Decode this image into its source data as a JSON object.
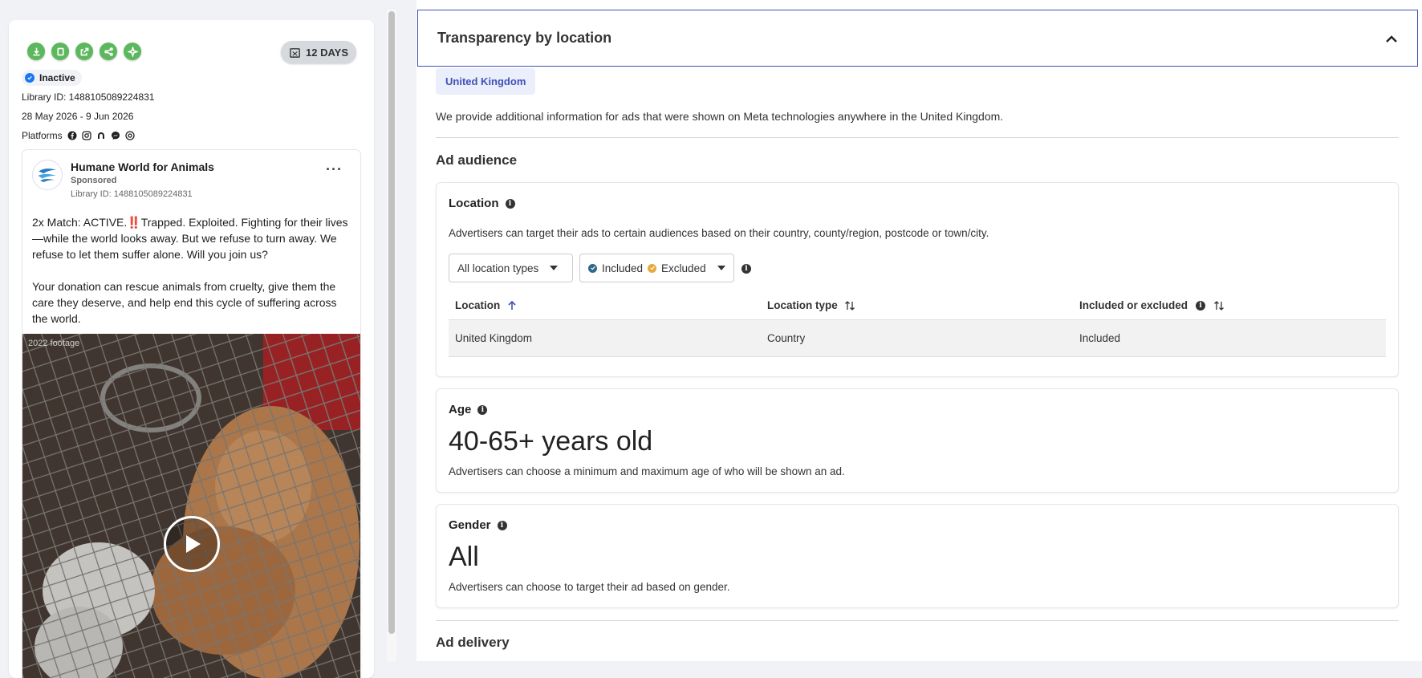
{
  "left": {
    "days_badge": "12 DAYS",
    "status": "Inactive",
    "library_id": "Library ID: 1488105089224831",
    "date_range": "28 May 2026 - 9 Jun 2026",
    "platforms_label": "Platforms",
    "ad": {
      "advertiser": "Humane World for Animals",
      "sponsored": "Sponsored",
      "library_id": "Library ID: 1488105089224831",
      "more": "···",
      "text": "2x Match: ACTIVE.‼️Trapped. Exploited. Fighting for their lives—while the world looks away. But we refuse to turn away. We refuse to let them suffer alone. Will you join us?\n\nYour donation can rescue animals from cruelty, give them the care they deserve, and help end this cycle of suffering across the world.",
      "media_caption": "2022 footage"
    }
  },
  "right": {
    "section_title": "Transparency by location",
    "country_chip": "United Kingdom",
    "intro": "We provide additional information for ads that were shown on Meta technologies anywhere in the United Kingdom.",
    "ad_audience_heading": "Ad audience",
    "location": {
      "title": "Location",
      "desc": "Advertisers can target their ads to certain audiences based on their country, county/region, postcode or town/city.",
      "filter_types": "All location types",
      "filter_included": "Included",
      "filter_excluded": "Excluded",
      "columns": [
        "Location",
        "Location type",
        "Included or excluded"
      ],
      "rows": [
        {
          "location": "United Kingdom",
          "type": "Country",
          "included": "Included"
        }
      ]
    },
    "age": {
      "title": "Age",
      "value": "40-65+ years old",
      "desc": "Advertisers can choose a minimum and maximum age of who will be shown an ad."
    },
    "gender": {
      "title": "Gender",
      "value": "All",
      "desc": "Advertisers can choose to target their ad based on gender."
    },
    "ad_delivery_heading": "Ad delivery"
  },
  "colors": {
    "accent": "#3f51b5",
    "action_green": "#5cb85c",
    "status_blue": "#1877f2"
  }
}
